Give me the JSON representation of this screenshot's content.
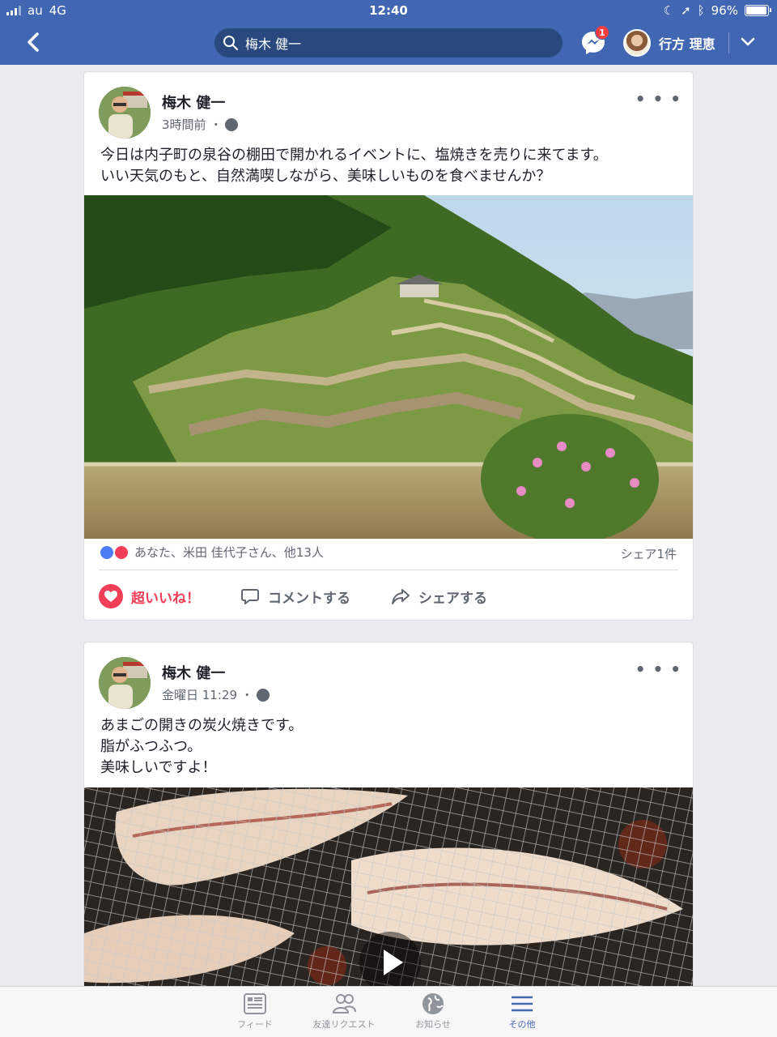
{
  "status": {
    "carrier": "au",
    "network": "4G",
    "time": "12:40",
    "battery": "96%",
    "battery_level": 0.96
  },
  "nav": {
    "search_value": "梅木 健一",
    "messenger_badge": "1",
    "user_name": "行方 理恵"
  },
  "posts": [
    {
      "author": "梅木 健一",
      "time": "3時間前 ・",
      "text": "今日は内子町の泉谷の棚田で開かれるイベントに、塩焼きを売りに来てます。\nいい天気のもと、自然満喫しながら、美味しいものを食べませんか？",
      "reactions": "あなた、米田 佳代子さん、他13人",
      "shares": "シェア1件",
      "actions": {
        "love": "超いいね！",
        "comment": "コメントする",
        "share": "シェアする"
      }
    },
    {
      "author": "梅木 健一",
      "time": "金曜日 11:29 ・",
      "text": "あまごの開きの炭火焼きです。\n脂がふつふつ。\n美味しいですよ！"
    }
  ],
  "tabs": [
    {
      "label": "フィード",
      "icon": "feed-icon"
    },
    {
      "label": "友達リクエスト",
      "icon": "friends-icon"
    },
    {
      "label": "お知らせ",
      "icon": "globe-icon"
    },
    {
      "label": "その他",
      "icon": "menu-icon"
    }
  ],
  "colors": {
    "brand": "#4267b2",
    "love": "#f33e58",
    "badge": "#fa3e3e"
  }
}
